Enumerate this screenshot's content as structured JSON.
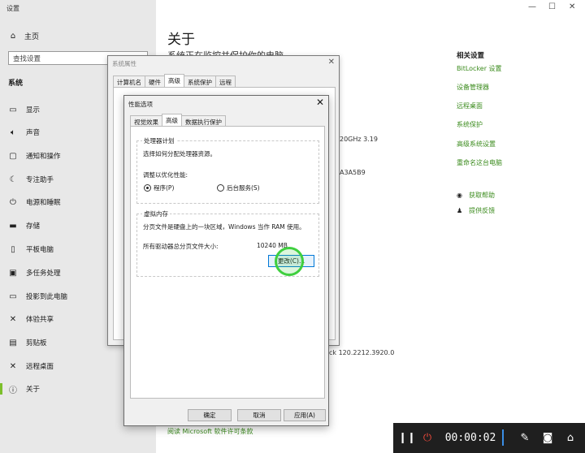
{
  "settings": {
    "window_title": "设置",
    "home": "主页",
    "search_placeholder": "查找设置",
    "section": "系统",
    "nav": [
      {
        "label": "显示",
        "icon": "monitor-icon"
      },
      {
        "label": "声音",
        "icon": "speaker-icon"
      },
      {
        "label": "通知和操作",
        "icon": "notification-icon"
      },
      {
        "label": "专注助手",
        "icon": "moon-icon"
      },
      {
        "label": "电源和睡眠",
        "icon": "power-icon"
      },
      {
        "label": "存储",
        "icon": "storage-icon"
      },
      {
        "label": "平板电脑",
        "icon": "tablet-icon"
      },
      {
        "label": "多任务处理",
        "icon": "multitask-icon"
      },
      {
        "label": "投影到此电脑",
        "icon": "project-icon"
      },
      {
        "label": "体验共享",
        "icon": "share-icon"
      },
      {
        "label": "剪贴板",
        "icon": "clipboard-icon"
      },
      {
        "label": "远程桌面",
        "icon": "remote-icon"
      },
      {
        "label": "关于",
        "icon": "info-icon"
      }
    ],
    "page_title": "关于",
    "page_subtitle": "系统正在监控并保护你的电脑",
    "related_title": "相关设置",
    "related_links": [
      "BitLocker 设置",
      "设备管理器",
      "远程桌面",
      "系统保护",
      "高级系统设置",
      "重命名这台电脑"
    ],
    "help": [
      "获取帮助",
      "提供反馈"
    ],
    "bg_texts": {
      "cpu": "20GHz  3.19",
      "id": "A3A5B9",
      "build": "ck 120.2212.3920.0",
      "license": "阅读 Microsoft 软件许可条款"
    }
  },
  "sysprops": {
    "title": "系统属性",
    "tabs": [
      "计算机名",
      "硬件",
      "高级",
      "系统保护",
      "远程"
    ],
    "active_tab": "高级"
  },
  "perf": {
    "title": "性能选项",
    "tabs": [
      "视觉效果",
      "高级",
      "数据执行保护"
    ],
    "active_tab": "高级",
    "cpu_group": "处理器计划",
    "cpu_desc": "选择如何分配处理器资源。",
    "optimize_label": "调整以优化性能:",
    "radio_programs": "程序(P)",
    "radio_services": "后台服务(S)",
    "vm_group": "虚拟内存",
    "vm_desc": "分页文件是硬盘上的一块区域，Windows 当作 RAM 使用。",
    "vm_total_label": "所有驱动器总分页文件大小:",
    "vm_total_value": "10240 MB",
    "change_btn": "更改(C)...",
    "ok_btn": "确定",
    "cancel_btn": "取消",
    "apply_btn": "应用(A)"
  },
  "recorder": {
    "time": "00:00:02"
  }
}
